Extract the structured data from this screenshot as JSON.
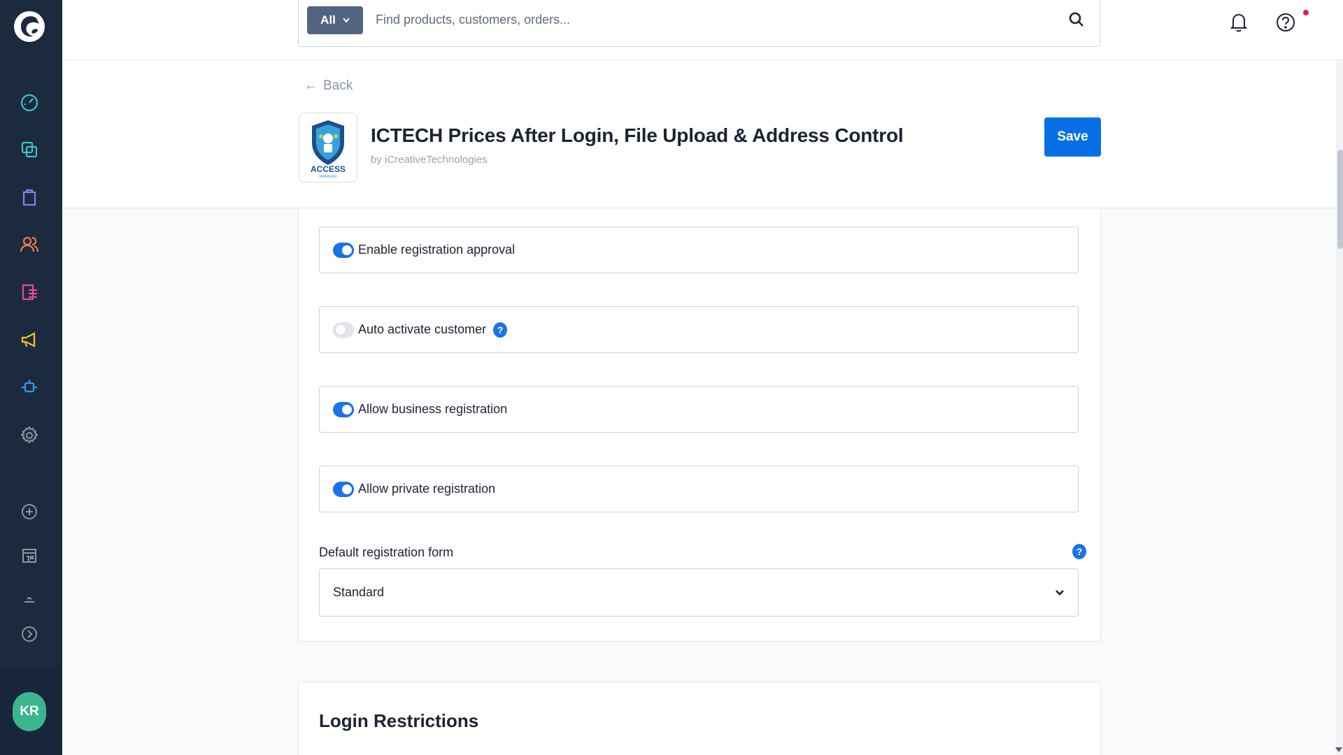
{
  "sidebar": {
    "items": [
      {
        "name": "dashboard-icon",
        "color": "#3fc1c9"
      },
      {
        "name": "catalog-icon",
        "color": "#3fc1c9"
      },
      {
        "name": "orders-icon",
        "color": "#8b7ef0"
      },
      {
        "name": "customers-icon",
        "color": "#f07b52"
      },
      {
        "name": "content-icon",
        "color": "#e04ba3"
      },
      {
        "name": "marketing-icon",
        "color": "#f5c518"
      },
      {
        "name": "extensions-icon",
        "color": "#2a9df4"
      },
      {
        "name": "settings-icon",
        "color": "#8a95a6"
      },
      {
        "name": "add-sales-channel-icon",
        "color": "#8a95a6"
      },
      {
        "name": "storefront-icon",
        "color": "#8a95a6"
      },
      {
        "name": "collapse-sidebar-icon",
        "color": "#8a95a6"
      }
    ],
    "avatar": {
      "initials": "KR",
      "color": "#3bb58e"
    }
  },
  "search": {
    "filter_label": "All",
    "placeholder": "Find products, customers, orders..."
  },
  "header": {
    "back_label": "Back",
    "app_title": "ICTECH Prices After Login, File Upload & Address Control",
    "app_vendor": "by iCreativeTechnologies",
    "logo_text": "ACCESS",
    "logo_subtext": "MANAGER",
    "save_label": "Save"
  },
  "settings": {
    "toggles": [
      {
        "label": "Enable registration approval",
        "enabled": true,
        "help": false
      },
      {
        "label": "Auto activate customer",
        "enabled": false,
        "help": true
      },
      {
        "label": "Allow business registration",
        "enabled": true,
        "help": false
      },
      {
        "label": "Allow private registration",
        "enabled": true,
        "help": false
      }
    ],
    "default_form": {
      "label": "Default registration form",
      "value": "Standard"
    }
  },
  "sections": {
    "login_restrictions_title": "Login Restrictions"
  },
  "colors": {
    "primary": "#0870e6",
    "sidebar_bg": "#1c2a3e",
    "notification_dot": "#e0233b"
  }
}
